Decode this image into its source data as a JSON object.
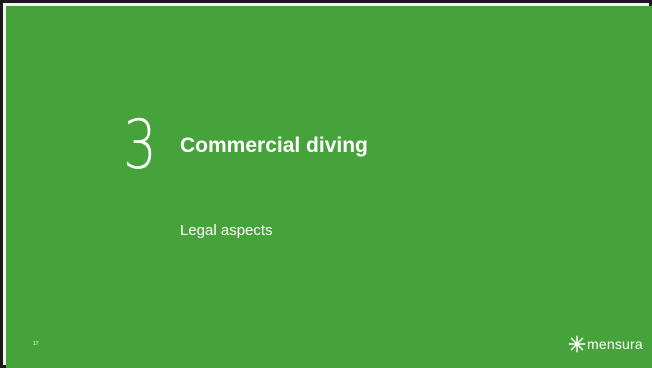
{
  "slide": {
    "section_number": "3",
    "title": "Commercial diving",
    "subtitle": "Legal aspects",
    "page_number": "17",
    "logo_text": "mensura"
  },
  "theme": {
    "background": "#46a23a",
    "text": "#ffffff",
    "border": "#1a1a1a"
  },
  "icons": {
    "logo": "mensura-star-logo"
  }
}
